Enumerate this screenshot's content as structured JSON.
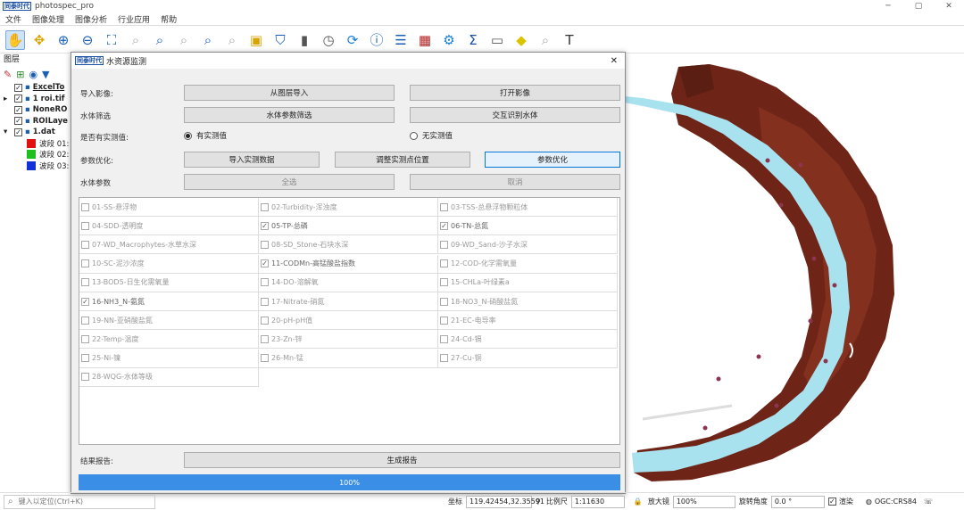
{
  "app": {
    "title": "photospec_pro",
    "logo_text": "同泰时代"
  },
  "window_controls": [
    "─",
    "▢",
    "✕"
  ],
  "menu": [
    "文件",
    "图像处理",
    "图像分析",
    "行业应用",
    "帮助"
  ],
  "toolbar_icons": [
    "pan-hand-icon",
    "move-icon",
    "zoom-in-icon",
    "zoom-out-icon",
    "zoom-full-icon",
    "zoom-layer-icon",
    "zoom-select-icon",
    "zoom-native-icon",
    "zoom-last-icon",
    "zoom-next-icon",
    "bookmark-icon",
    "select-feature-icon",
    "identify-icon",
    "clock-icon",
    "refresh-icon",
    "info-icon",
    "attribute-table-icon",
    "field-calc-icon",
    "processing-gear-icon",
    "statistics-sigma-icon",
    "measure-icon",
    "annotation-icon",
    "map-tips-icon",
    "text-icon"
  ],
  "layers_panel": {
    "header": "图层",
    "items": [
      {
        "label": "ExcelTo",
        "indent": 0,
        "bold": true,
        "underline": true,
        "checked": true,
        "expander": ""
      },
      {
        "label": "1 roi.tif",
        "indent": 0,
        "bold": true,
        "checked": true,
        "expander": "▸"
      },
      {
        "label": "NoneRO",
        "indent": 0,
        "bold": true,
        "checked": true,
        "expander": ""
      },
      {
        "label": "ROILaye",
        "indent": 0,
        "bold": true,
        "checked": true,
        "expander": ""
      },
      {
        "label": "1.dat",
        "indent": 0,
        "bold": true,
        "checked": true,
        "expander": "▾"
      },
      {
        "label": "波段 01:",
        "indent": 1,
        "swatch": "#e01010"
      },
      {
        "label": "波段 02:",
        "indent": 1,
        "swatch": "#1ec01e"
      },
      {
        "label": "波段 03:",
        "indent": 1,
        "swatch": "#1030d8"
      }
    ]
  },
  "dialog": {
    "logo_text": "同泰时代",
    "title": "水资源监测",
    "close": "✕",
    "import_label": "导入影像:",
    "btn_from_layer": "从图层导入",
    "btn_open_image": "打开影像",
    "filter_label": "水体筛选",
    "btn_param_filter": "水体参数筛选",
    "btn_interactive": "交互识别水体",
    "measured_label": "是否有实测值:",
    "radio_yes": "有实测值",
    "radio_no": "无实测值",
    "optimize_label": "参数优化:",
    "btn_import_measured": "导入实测数据",
    "btn_adjust_points": "调整实测点位置",
    "btn_param_opt": "参数优化",
    "water_params_label": "水体参数",
    "btn_select_all": "全选",
    "btn_cancel": "取消",
    "params": [
      {
        "label": "01-SS-悬浮物",
        "checked": false
      },
      {
        "label": "02-Turbidity-浑浊度",
        "checked": false
      },
      {
        "label": "03-TSS-总悬浮物颗粒体",
        "checked": false
      },
      {
        "label": "04-SDD-透明度",
        "checked": false
      },
      {
        "label": "05-TP-总磷",
        "checked": true
      },
      {
        "label": "06-TN-总氮",
        "checked": true
      },
      {
        "label": "07-WD_Macrophytes-水草水深",
        "checked": false
      },
      {
        "label": "08-SD_Stone-石块水深",
        "checked": false
      },
      {
        "label": "09-WD_Sand-沙子水深",
        "checked": false
      },
      {
        "label": "10-SC-泥沙浓度",
        "checked": false
      },
      {
        "label": "11-CODMn-高锰酸盐指数",
        "checked": true
      },
      {
        "label": "12-COD-化学需氧量",
        "checked": false
      },
      {
        "label": "13-BOD5-日生化需氧量",
        "checked": false
      },
      {
        "label": "14-DO-溶解氧",
        "checked": false
      },
      {
        "label": "15-CHLa-叶绿素a",
        "checked": false
      },
      {
        "label": "16-NH3_N-氨氮",
        "checked": true
      },
      {
        "label": "17-Nitrate-硝氮",
        "checked": false
      },
      {
        "label": "18-NO3_N-硝酸盐氮",
        "checked": false
      },
      {
        "label": "19-NN-亚硝酸盐氮",
        "checked": false
      },
      {
        "label": "20-pH-pH值",
        "checked": false
      },
      {
        "label": "21-EC-电导率",
        "checked": false
      },
      {
        "label": "22-Temp-温度",
        "checked": false
      },
      {
        "label": "23-Zn-锌",
        "checked": false
      },
      {
        "label": "24-Cd-镉",
        "checked": false
      },
      {
        "label": "25-Ni-镍",
        "checked": false
      },
      {
        "label": "26-Mn-锰",
        "checked": false
      },
      {
        "label": "27-Cu-铜",
        "checked": false
      },
      {
        "label": "28-WQG-水体等级",
        "checked": false
      }
    ],
    "report_label": "结果报告:",
    "btn_generate_report": "生成报告",
    "progress_text": "100%",
    "progress_value": 1.0
  },
  "statusbar": {
    "search_placeholder": "键入以定位(Ctrl+K)",
    "coord_label": "坐标",
    "coord_value": "119.42454,32.35591",
    "scale_label": "比例尺",
    "scale_value": "1:11630",
    "magnifier_label": "放大镜",
    "magnifier_value": "100%",
    "rotation_label": "旋转角度",
    "rotation_value": "0.0 °",
    "render_label": "渲染",
    "crs": "OGC:CRS84"
  },
  "colors": {
    "accent": "#3a8ee6",
    "water": "#a8e2ef",
    "land": "#7a2a1a"
  }
}
